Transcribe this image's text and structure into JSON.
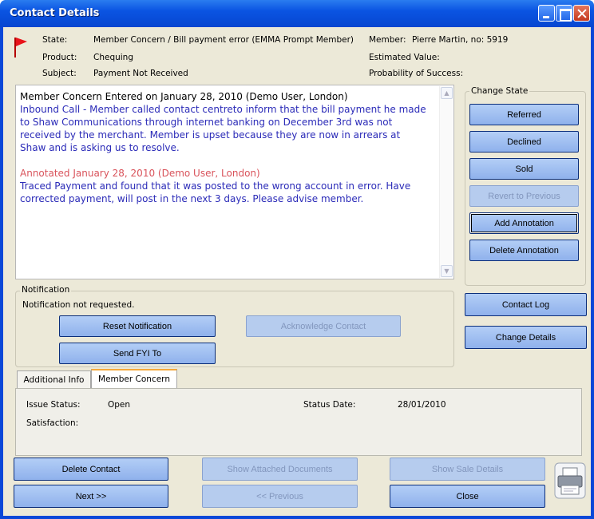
{
  "window": {
    "title": "Contact Details"
  },
  "header": {
    "state_label": "State:",
    "state_value": "Member Concern / Bill payment error (EMMA Prompt Member)",
    "product_label": "Product:",
    "product_value": "Chequing",
    "subject_label": "Subject:",
    "subject_value": "Payment Not Received",
    "member_label": "Member:",
    "member_value": "Pierre Martin, no: 5919",
    "estimated_value_label": "Estimated Value:",
    "probability_label": "Probability of Success:"
  },
  "notes": {
    "entry1_header": "Member Concern Entered on January 28, 2010 (Demo User, London)",
    "entry1_line1": "Inbound Call - Member called contact centreto inform that the bill payment he made",
    "entry1_line2": "to Shaw Communications through internet banking on December 3rd was not",
    "entry1_line3": "received by the merchant. Member is upset because they are now in arrears at",
    "entry1_line4": "Shaw and is asking us to resolve.",
    "entry2_header": "Annotated January 28, 2010 (Demo User, London)",
    "entry2_line1": "Traced Payment and found that it was posted to the wrong account in error. Have",
    "entry2_line2": "corrected payment, will post in the next 3 days. Please advise member."
  },
  "change_state": {
    "caption": "Change State",
    "referred": "Referred",
    "declined": "Declined",
    "sold": "Sold",
    "revert": "Revert to Previous",
    "add_annotation": "Add Annotation",
    "delete_annotation": "Delete Annotation"
  },
  "notification": {
    "caption": "Notification",
    "status": "Notification not requested.",
    "reset": "Reset Notification",
    "acknowledge": "Acknowledge Contact",
    "send_fyi": "Send FYI To"
  },
  "side_buttons": {
    "contact_log": "Contact Log",
    "change_details": "Change Details"
  },
  "tabs": [
    {
      "label": "Additional Info"
    },
    {
      "label": "Member Concern"
    }
  ],
  "member_concern": {
    "issue_status_label": "Issue Status:",
    "issue_status_value": "Open",
    "status_date_label": "Status Date:",
    "status_date_value": "28/01/2010",
    "satisfaction_label": "Satisfaction:"
  },
  "footer": {
    "delete_contact": "Delete Contact",
    "show_attached": "Show Attached Documents",
    "show_sale": "Show Sale Details",
    "next": "Next >>",
    "previous": "<< Previous",
    "close": "Close"
  },
  "colors": {
    "titlebar": "#0A54E2",
    "note_blue": "#2B2BB8",
    "note_red": "#D9535B",
    "flag_red": "#E8131A",
    "tab_accent": "#F5A93C"
  }
}
